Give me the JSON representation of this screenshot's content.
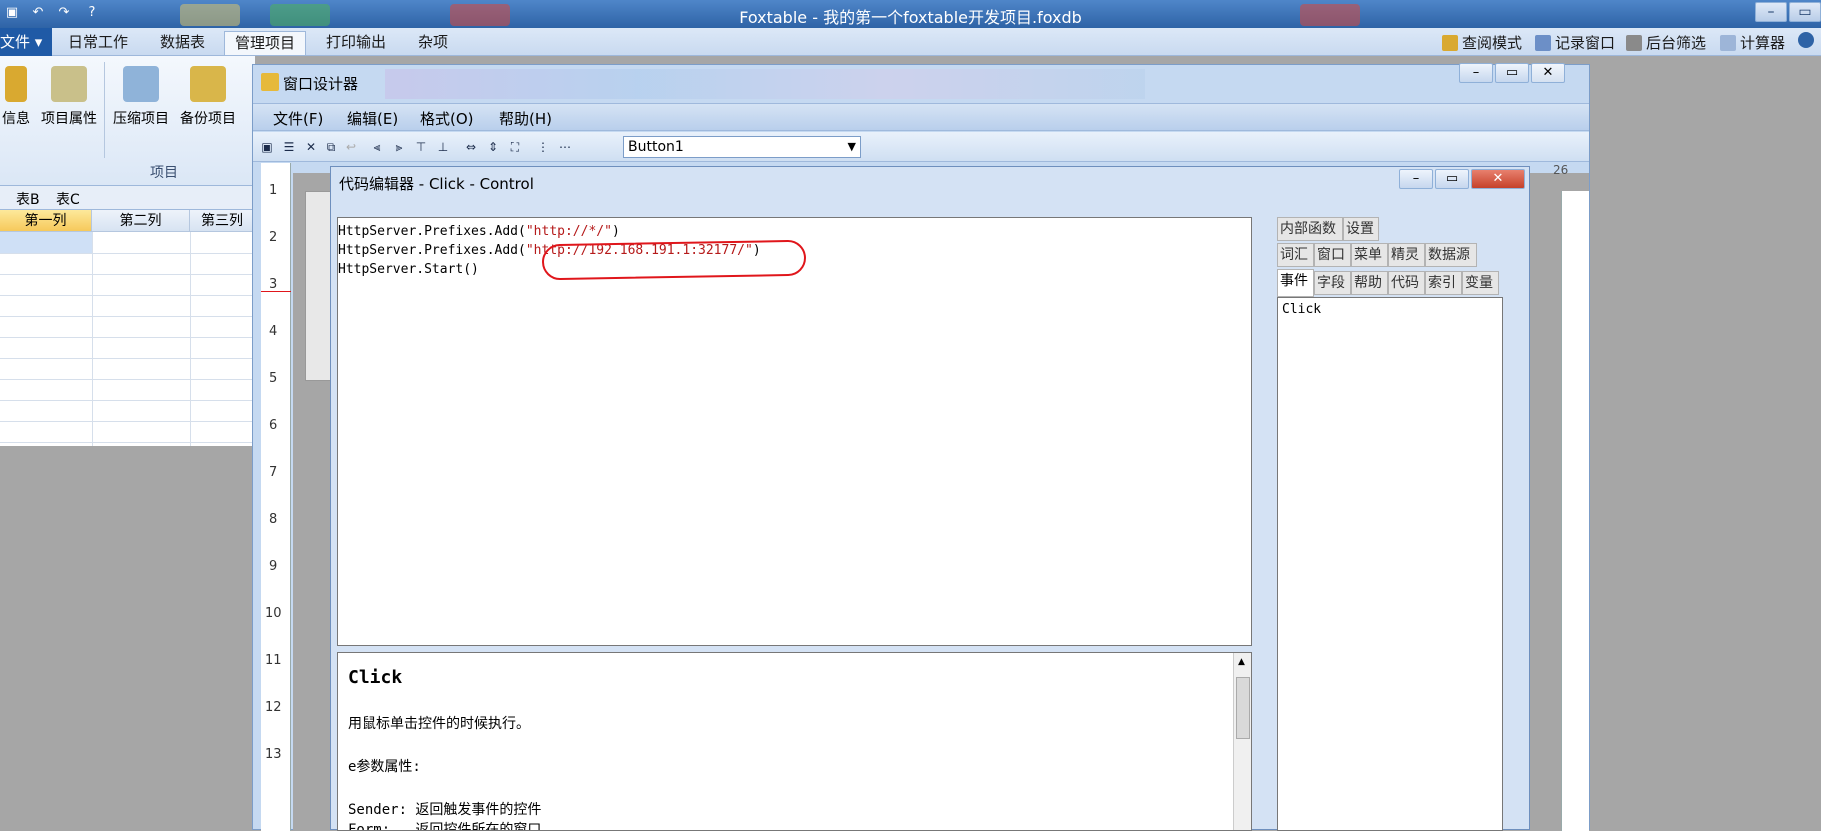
{
  "app": {
    "title": "Foxtable - 我的第一个foxtable开发项目.foxdb"
  },
  "ribbon": {
    "file_tab": "文件",
    "tabs": [
      "日常工作",
      "数据表",
      "管理项目",
      "打印输出",
      "杂项"
    ],
    "active_tab": "管理项目",
    "right_items": [
      "查阅模式",
      "记录窗口",
      "后台筛选",
      "计算器"
    ],
    "buttons": [
      "信息",
      "项目属性",
      "压缩项目",
      "备份项目"
    ],
    "group_label": "项目"
  },
  "sheet": {
    "tabs": [
      "表B",
      "表C"
    ],
    "columns": [
      "第一列",
      "第二列",
      "第三列"
    ]
  },
  "designer": {
    "title": "窗口设计器",
    "menu": [
      "文件(F)",
      "编辑(E)",
      "格式(O)",
      "帮助(H)"
    ],
    "control_select": "Button1",
    "ruler_numbers": [
      "1",
      "2",
      "3",
      "4",
      "5",
      "6",
      "7",
      "8",
      "9",
      "10",
      "11",
      "12",
      "13"
    ],
    "top_ruler_end": "26"
  },
  "editor": {
    "title": "代码编辑器 - Click - Control",
    "code_lines": [
      {
        "pre": "HttpServer.Prefixes.Add(",
        "str": "\"http://*/\"",
        "post": ")"
      },
      {
        "pre": "HttpServer.Prefixes.Add(",
        "str": "\"http://192.168.191.1:32177/\"",
        "post": ")"
      },
      {
        "pre": "HttpServer.Start()",
        "str": "",
        "post": ""
      }
    ],
    "help_title": "Click",
    "help_lines": [
      "用鼠标单击控件的时候执行。",
      "e参数属性:",
      "Sender: 返回触发事件的控件",
      "Form:   返回控件所在的窗口"
    ],
    "side_tabs_row1": [
      "内部函数",
      "设置"
    ],
    "side_tabs_row2": [
      "词汇",
      "窗口",
      "菜单",
      "精灵",
      "数据源"
    ],
    "side_tabs_row3": [
      "事件",
      "字段",
      "帮助",
      "代码",
      "索引",
      "变量"
    ],
    "side_list": [
      "Click"
    ]
  },
  "colors": {
    "title_bar": "#2e63a6",
    "highlight_circle": "#e0161b",
    "code_string": "#b51a1a"
  }
}
